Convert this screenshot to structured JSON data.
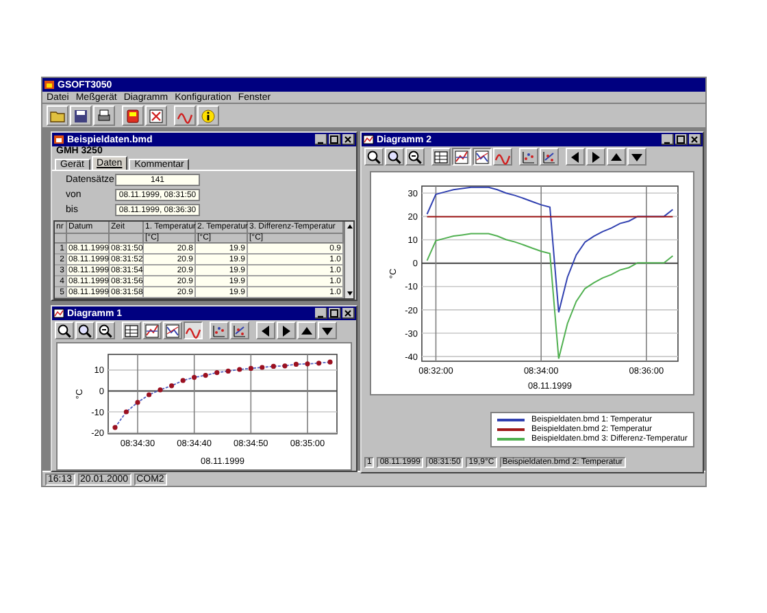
{
  "window": {
    "title": "GSOFT3050"
  },
  "menu": [
    "Datei",
    "Meßgerät",
    "Diagramm",
    "Konfiguration",
    "Fenster"
  ],
  "toolbar": [
    {
      "kind": "open"
    },
    {
      "kind": "save"
    },
    {
      "kind": "print"
    },
    {
      "kind": "device"
    },
    {
      "kind": "cross"
    },
    {
      "kind": "curve"
    },
    {
      "kind": "info"
    }
  ],
  "data_window": {
    "title": "Beispieldaten.bmd",
    "device": "GMH 3250",
    "tabs": [
      {
        "label": "Gerät",
        "selected": false
      },
      {
        "label": "Daten",
        "selected": true
      },
      {
        "label": "Kommentar",
        "selected": false
      }
    ],
    "fields": [
      {
        "label": "Datensätze",
        "value": "141"
      },
      {
        "label": "von",
        "value": "08.11.1999, 08:31:50"
      },
      {
        "label": "bis",
        "value": "08.11.1999, 08:36:30"
      }
    ],
    "table": {
      "columns": [
        {
          "label": "nr"
        },
        {
          "label": "Datum"
        },
        {
          "label": "Zeit"
        },
        {
          "label": "1. Temperatur",
          "unit": "[°C]"
        },
        {
          "label": "2. Temperatur",
          "unit": "[°C]"
        },
        {
          "label": "3. Differenz-Temperatur",
          "unit": "[°C]"
        }
      ],
      "rows": [
        [
          "1",
          "08.11.1999",
          "08:31:50",
          "20.8",
          "19.9",
          "0.9"
        ],
        [
          "2",
          "08.11.1999",
          "08:31:52",
          "20.9",
          "19.9",
          "1.0"
        ],
        [
          "3",
          "08.11.1999",
          "08:31:54",
          "20.9",
          "19.9",
          "1.0"
        ],
        [
          "4",
          "08.11.1999",
          "08:31:56",
          "20.9",
          "19.9",
          "1.0"
        ],
        [
          "5",
          "08.11.1999",
          "08:31:58",
          "20.9",
          "19.9",
          "1.0"
        ]
      ]
    }
  },
  "diagram_1": {
    "title": "Diagramm 1",
    "toolbar": [
      {
        "kind": "zoom-in",
        "pressed": false
      },
      {
        "kind": "zoom-out",
        "pressed": false
      },
      {
        "kind": "zoom-fit",
        "pressed": false
      },
      {
        "kind": "table",
        "pressed": false
      },
      {
        "kind": "chart-a",
        "pressed": false
      },
      {
        "kind": "chart-b",
        "pressed": false
      },
      {
        "kind": "curve",
        "pressed": true
      },
      {
        "kind": "points-a",
        "pressed": false
      },
      {
        "kind": "points-b",
        "pressed": false
      },
      {
        "kind": "left",
        "pressed": false
      },
      {
        "kind": "right",
        "pressed": false
      },
      {
        "kind": "up",
        "pressed": false
      },
      {
        "kind": "down",
        "pressed": false
      }
    ],
    "chart_data": {
      "type": "line",
      "xlabel": "08.11.1999",
      "ylabel": "°C",
      "categories": [
        null,
        null,
        "08:34:30",
        null,
        null,
        null,
        null,
        "08:34:40",
        null,
        null,
        null,
        null,
        "08:34:50",
        null,
        null,
        null,
        null,
        "08:35:00",
        null,
        null
      ],
      "series": [
        {
          "color": "#9b1020",
          "line_style": "dashed",
          "marker": "circle",
          "values": [
            -17.5,
            -10,
            -5.5,
            -1.8,
            0.5,
            2.5,
            5,
            6.5,
            7.5,
            8.8,
            9.5,
            10.3,
            10.8,
            11.3,
            11.8,
            12,
            12.8,
            13,
            13.3,
            13.8
          ]
        }
      ],
      "ylim": [
        -20.5,
        17.5
      ],
      "yticks": [
        -20,
        -10,
        0,
        10
      ],
      "grid": true
    }
  },
  "diagram_2": {
    "title": "Diagramm 2",
    "toolbar": [
      {
        "kind": "zoom-in",
        "pressed": false
      },
      {
        "kind": "zoom-out",
        "pressed": false
      },
      {
        "kind": "zoom-fit",
        "pressed": false
      },
      {
        "kind": "table",
        "pressed": false
      },
      {
        "kind": "chart-a",
        "pressed": true
      },
      {
        "kind": "chart-b",
        "pressed": true
      },
      {
        "kind": "curve",
        "pressed": false
      },
      {
        "kind": "points-a",
        "pressed": false
      },
      {
        "kind": "points-b",
        "pressed": false
      },
      {
        "kind": "left",
        "pressed": false
      },
      {
        "kind": "right",
        "pressed": false
      },
      {
        "kind": "up",
        "pressed": false
      },
      {
        "kind": "down",
        "pressed": false
      }
    ],
    "chart_data": {
      "type": "line",
      "xlabel": "08.11.1999",
      "ylabel": "°C",
      "categories": [
        null,
        "08:32:00",
        null,
        null,
        null,
        null,
        null,
        null,
        null,
        null,
        null,
        null,
        null,
        "08:34:00",
        null,
        null,
        null,
        null,
        null,
        null,
        null,
        null,
        null,
        null,
        null,
        "08:36:00",
        null,
        null,
        null
      ],
      "series": [
        {
          "name": "Beispieldaten.bmd 1: Temperatur",
          "color": "#3040b0",
          "values": [
            21,
            29.5,
            30.5,
            31.5,
            32,
            32.5,
            32.5,
            32.5,
            31.5,
            30,
            29,
            27.7,
            26.3,
            25,
            24,
            -21,
            -6,
            3.5,
            9,
            11.5,
            13.5,
            15,
            17,
            18,
            20,
            20,
            20,
            20,
            23
          ]
        },
        {
          "name": "Beispieldaten.bmd 2: Temperatur",
          "color": "#a01818",
          "values": [
            19.9,
            19.9,
            19.9,
            19.9,
            19.9,
            19.9,
            19.9,
            19.9,
            19.9,
            19.9,
            19.9,
            19.9,
            19.9,
            19.9,
            19.9,
            19.9,
            19.9,
            19.9,
            19.9,
            19.9,
            19.9,
            19.9,
            19.9,
            19.9,
            19.9,
            19.9,
            19.9,
            19.9,
            19.9
          ]
        },
        {
          "name": "Beispieldaten.bmd 3: Differenz-Temperatur",
          "color": "#50b050",
          "values": [
            1.1,
            9.6,
            10.6,
            11.6,
            12.1,
            12.6,
            12.6,
            12.6,
            11.6,
            10.1,
            9.1,
            7.8,
            6.4,
            5.1,
            4.1,
            -40.9,
            -25.9,
            -16.4,
            -10.9,
            -8.4,
            -6.4,
            -4.9,
            -2.9,
            -1.9,
            0.1,
            0.1,
            0.1,
            0.1,
            3.1
          ]
        }
      ],
      "ylim": [
        -42,
        33
      ],
      "yticks": [
        -40,
        -30,
        -20,
        -10,
        0,
        10,
        20,
        30
      ],
      "grid": true
    },
    "status": [
      "1",
      "08.11.1999",
      "08:31:50",
      "19,9°C",
      "Beispieldaten.bmd 2: Temperatur"
    ]
  },
  "status_bar": [
    "16:13",
    "20.01.2000",
    "COM2"
  ]
}
